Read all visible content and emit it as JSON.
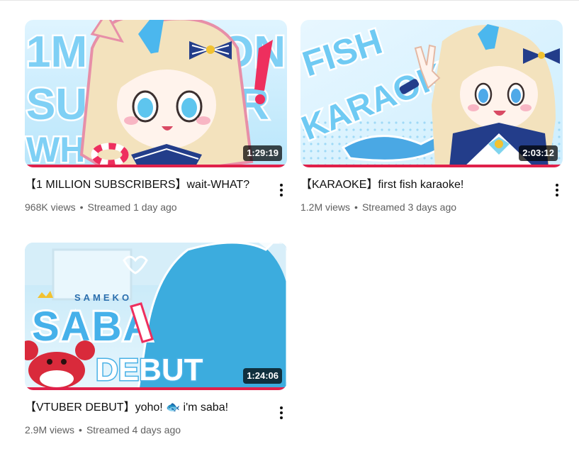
{
  "videos": [
    {
      "title": "【1 MILLION SUBSCRIBERS】wait-WHAT?",
      "views": "968K views",
      "streamed": "Streamed 1 day ago",
      "duration": "1:29:19",
      "thumb_text": "1M SUBSCRIBER WHAT",
      "watched_progress": 1.0
    },
    {
      "title": "【KARAOKE】first fish karaoke!",
      "views": "1.2M views",
      "streamed": "Streamed 3 days ago",
      "duration": "2:03:12",
      "thumb_text": "FISH KARAOKE",
      "watched_progress": 1.0
    },
    {
      "title": "【VTUBER DEBUT】yoho! 🐟 i'm saba!",
      "views": "2.9M views",
      "streamed": "Streamed 4 days ago",
      "duration": "1:24:06",
      "thumb_text_top": "SAMEKO",
      "thumb_text_main": "SABA",
      "thumb_text_bottom": "DEBUT",
      "watched_progress": 1.0
    }
  ],
  "separator": "•",
  "icons": {
    "more": "more-vert-icon"
  },
  "colors": {
    "progress": "#e0204a",
    "title": "#0f0f0f",
    "meta": "#606060"
  }
}
